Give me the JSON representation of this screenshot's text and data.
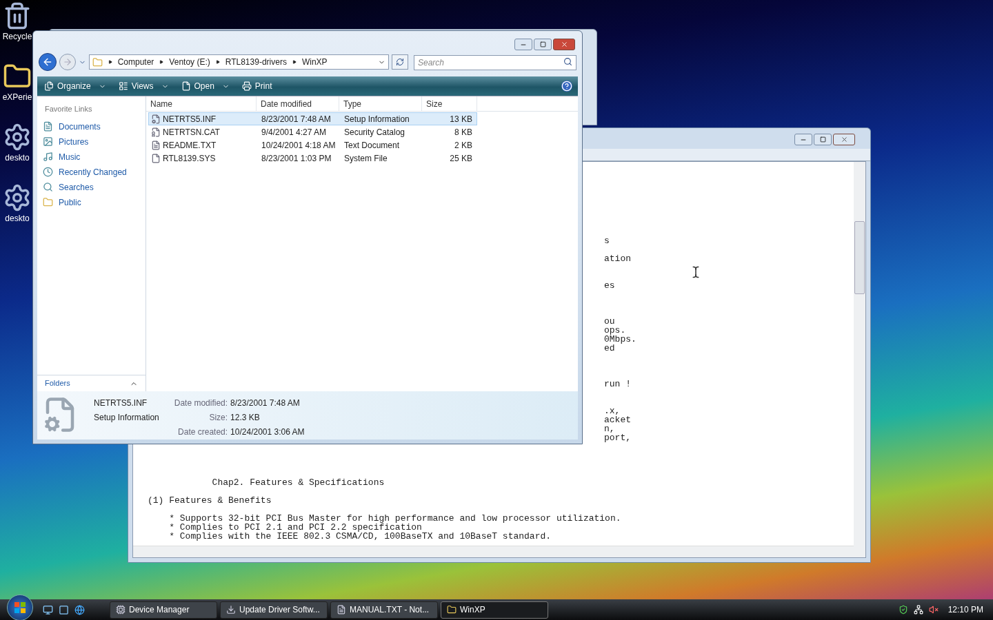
{
  "desktop_icons": [
    {
      "label": "Recycle",
      "kind": "bin"
    },
    {
      "label": "eXPerie",
      "kind": "folder"
    },
    {
      "label": "deskto",
      "kind": "gear"
    },
    {
      "label": "deskto",
      "kind": "gear"
    }
  ],
  "explorer": {
    "breadcrumb": [
      "Computer",
      "Ventoy (E:)",
      "RTL8139-drivers",
      "WinXP"
    ],
    "search": {
      "placeholder": "Search"
    },
    "toolbar": [
      {
        "label": "Organize",
        "kind": "organize",
        "menu": true
      },
      {
        "label": "Views",
        "kind": "views",
        "menu": true
      },
      {
        "label": "Open",
        "kind": "open",
        "menu": true
      },
      {
        "label": "Print",
        "kind": "print",
        "menu": false
      }
    ],
    "favorites_title": "Favorite Links",
    "favorites": [
      {
        "label": "Documents",
        "kind": "documents"
      },
      {
        "label": "Pictures",
        "kind": "pictures"
      },
      {
        "label": "Music",
        "kind": "music"
      },
      {
        "label": "Recently Changed",
        "kind": "recent"
      },
      {
        "label": "Searches",
        "kind": "searches"
      },
      {
        "label": "Public",
        "kind": "public"
      }
    ],
    "folders_label": "Folders",
    "columns": [
      "Name",
      "Date modified",
      "Type",
      "Size"
    ],
    "files": [
      {
        "name": "NETRTS5.INF",
        "date": "8/23/2001 7:48 AM",
        "type": "Setup Information",
        "size": "13 KB",
        "kind": "inf",
        "selected": true
      },
      {
        "name": "NETRTSN.CAT",
        "date": "9/4/2001 4:27 AM",
        "type": "Security Catalog",
        "size": "8 KB",
        "kind": "cat",
        "selected": false
      },
      {
        "name": "README.TXT",
        "date": "10/24/2001 4:18 AM",
        "type": "Text Document",
        "size": "2 KB",
        "kind": "txt",
        "selected": false
      },
      {
        "name": "RTL8139.SYS",
        "date": "8/23/2001 1:03 PM",
        "type": "System File",
        "size": "25 KB",
        "kind": "sys",
        "selected": false
      }
    ],
    "details": {
      "name": "NETRTS5.INF",
      "type": "Setup Information",
      "fields": [
        {
          "label": "Date modified:",
          "value": "8/23/2001 7:48 AM"
        },
        {
          "label": "Size:",
          "value": "12.3 KB"
        },
        {
          "label": "Date created:",
          "value": "10/24/2001 3:06 AM"
        }
      ]
    }
  },
  "notepad": {
    "fragments": [
      "s",
      "ation",
      "es",
      "ou",
      "ops.",
      "0Mbps.",
      "ed",
      "run !",
      ".x,",
      "acket",
      "n,",
      "port,"
    ],
    "lines": [
      "Chap2. Features & Specifications",
      "(1) Features & Benefits",
      "* Supports 32-bit PCI Bus Master for high performance and low processor utilization.",
      "* Complies to PCI 2.1 and PCI 2.2 specification",
      "* Complies with the IEEE 802.3 CSMA/CD, 100BaseTX and 10BaseT standard."
    ]
  },
  "taskbar": {
    "tasks": [
      {
        "label": "Device Manager",
        "kind": "device",
        "selected": false
      },
      {
        "label": "Update Driver Softw...",
        "kind": "update",
        "selected": false
      },
      {
        "label": "MANUAL.TXT - Not...",
        "kind": "notepad",
        "selected": false
      },
      {
        "label": "WinXP",
        "kind": "folder",
        "selected": true
      }
    ],
    "clock": "12:10 PM"
  }
}
